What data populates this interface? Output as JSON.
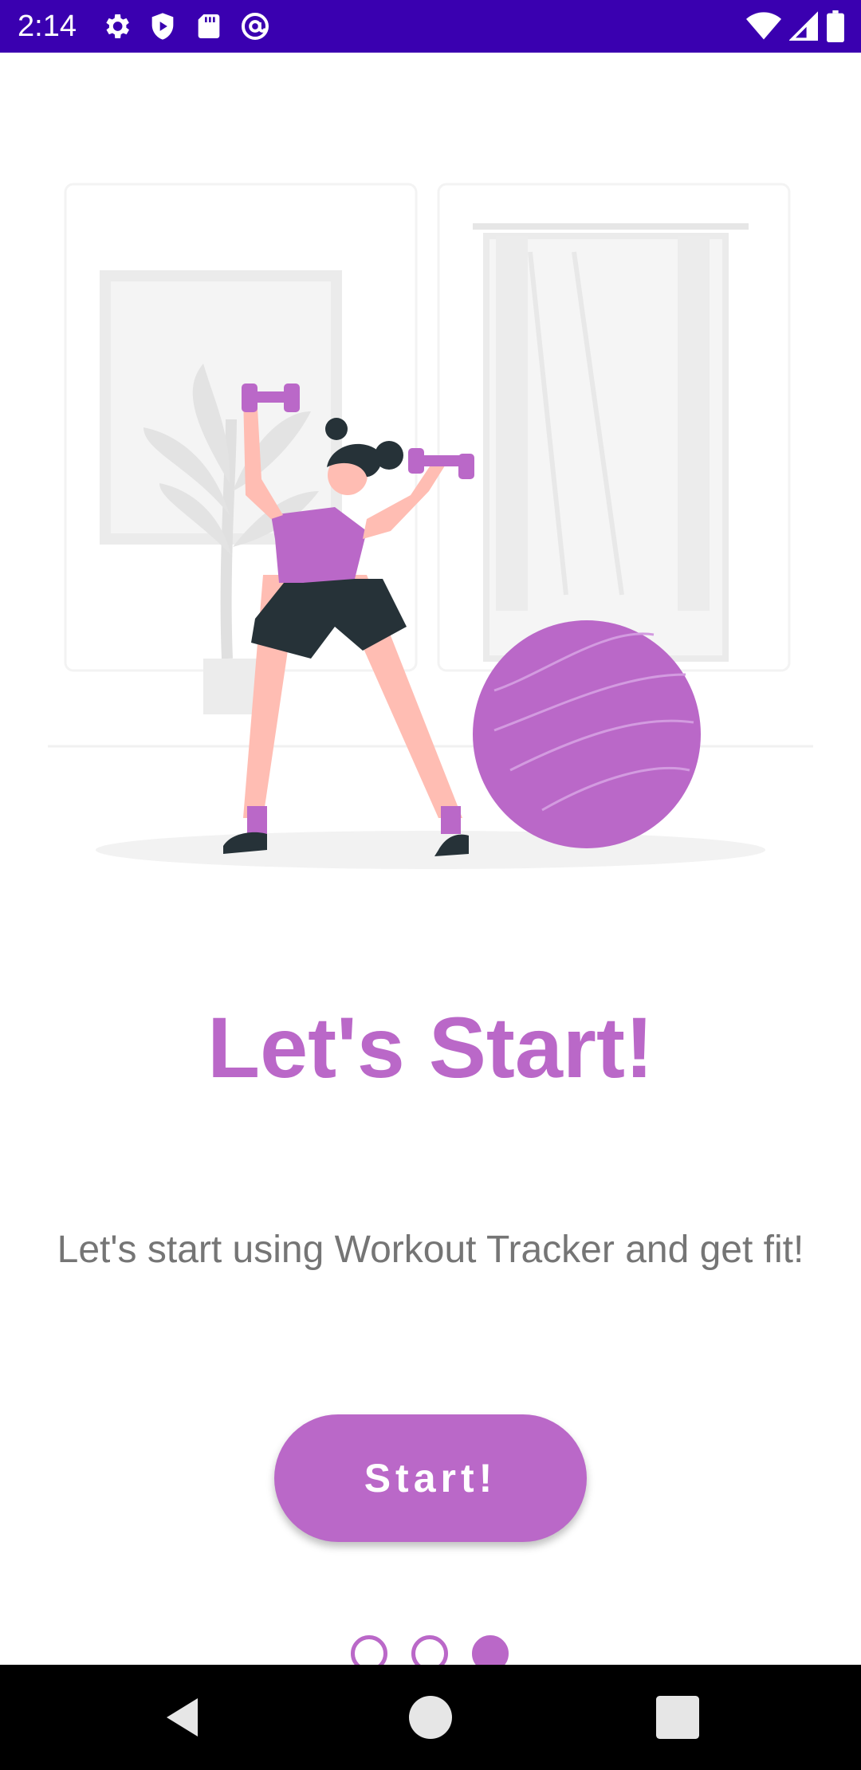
{
  "status_bar": {
    "time": "2:14",
    "background": "#3a00b0",
    "left_icons": [
      "settings-gear-icon",
      "shield-play-icon",
      "sd-card-icon",
      "at-sign-icon"
    ],
    "right_icons": [
      "wifi-icon",
      "cellular-signal-icon",
      "battery-icon"
    ]
  },
  "onboarding": {
    "illustration": "woman-lifting-dumbbells-with-exercise-ball",
    "title": "Let's Start!",
    "subtitle": "Let's start using Workout Tracker and get fit!",
    "button_label": "Start!",
    "accent_color": "#ba68c8",
    "page_indicator": {
      "total": 3,
      "current": 3
    }
  },
  "nav_bar": {
    "buttons": [
      "back-icon",
      "home-icon",
      "recents-icon"
    ]
  }
}
